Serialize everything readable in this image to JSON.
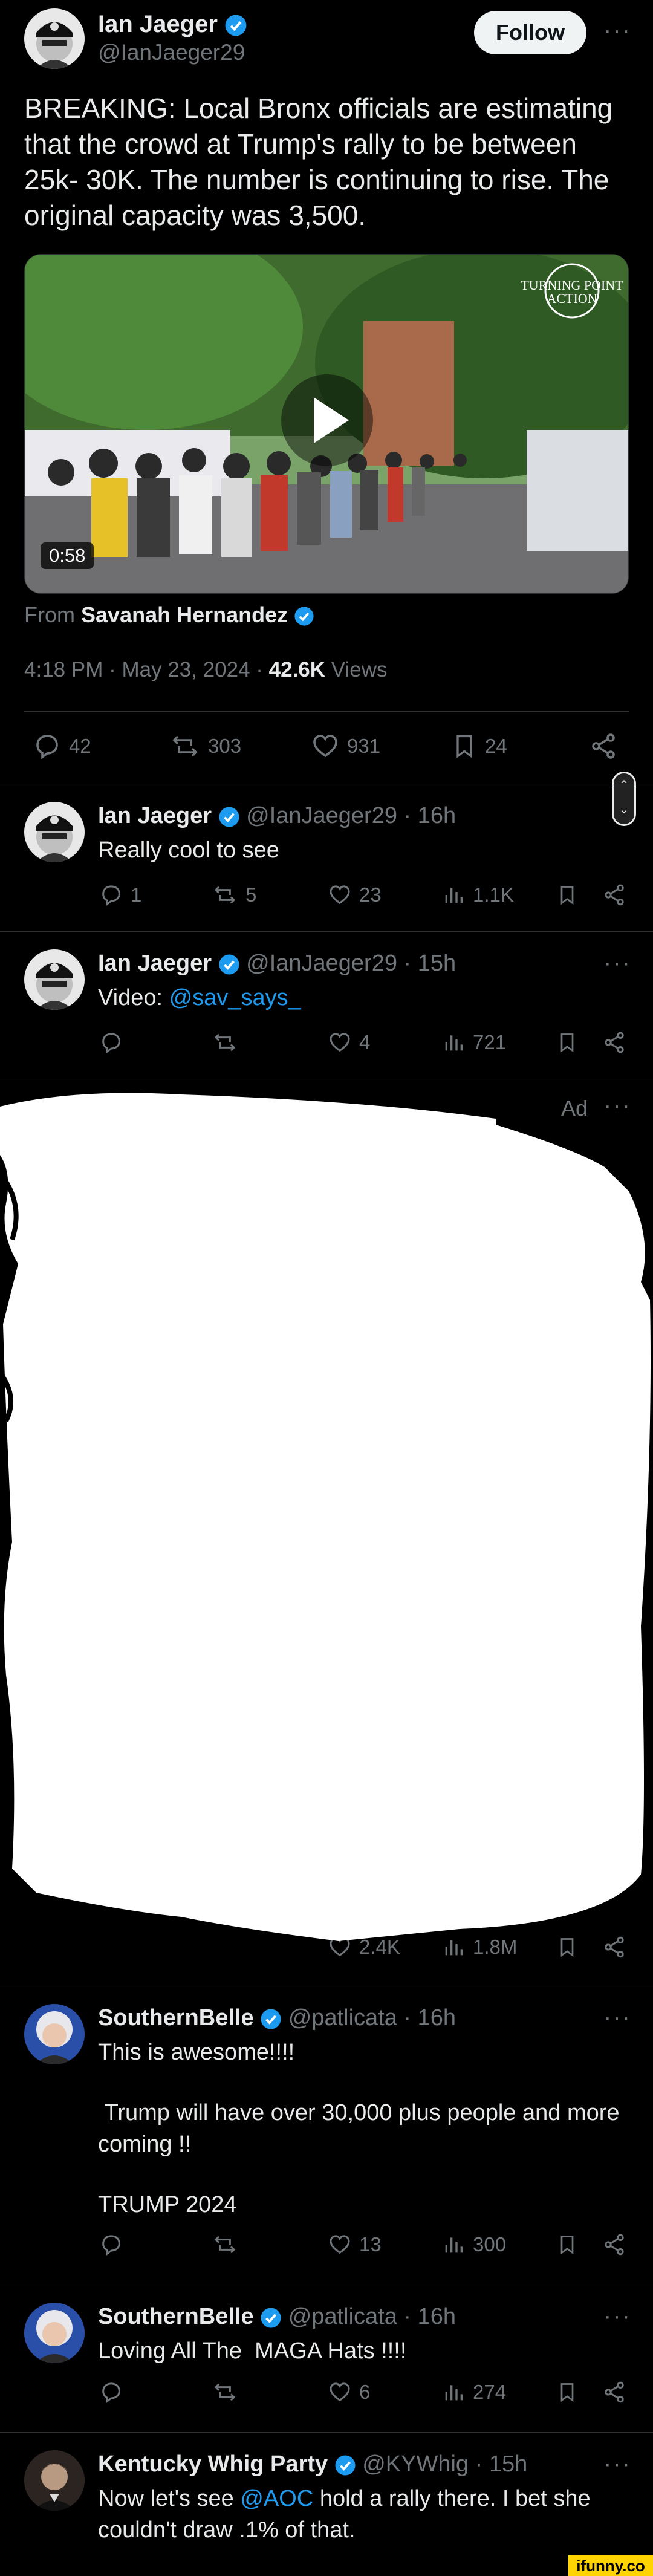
{
  "main_tweet": {
    "author_name": "Ian Jaeger",
    "handle": "@IanJaeger29",
    "follow_label": "Follow",
    "text": "BREAKING: Local Bronx officials are estimating that the crowd at Trump's rally to be between 25k- 30K. The number is continuing to rise. The original capacity was 3,500.",
    "video_duration": "0:58",
    "video_watermark": "TURNING POINT ACTION",
    "from_label": "From",
    "from_name": "Savanah Hernandez",
    "timestamp": "4:18 PM · May 23, 2024 · ",
    "views_count": "42.6K",
    "views_label": " Views",
    "stats": {
      "replies": "42",
      "reposts": "303",
      "likes": "931",
      "bookmarks": "24"
    }
  },
  "replies": [
    {
      "author_name": "Ian Jaeger",
      "handle_time": "@IanJaeger29 · 16h",
      "text": "Really cool to see",
      "stats": {
        "replies": "1",
        "reposts": "5",
        "likes": "23",
        "views": "1.1K"
      }
    },
    {
      "author_name": "Ian Jaeger",
      "handle_time": "@IanJaeger29 · 15h",
      "text_prefix": "Video: ",
      "mention": "@sav_says_",
      "stats": {
        "replies": "",
        "reposts": "",
        "likes": "4",
        "views": "721"
      }
    }
  ],
  "ad": {
    "label": "Ad",
    "stats": {
      "likes": "2.4K",
      "views": "1.8M"
    }
  },
  "replies_after_ad": [
    {
      "author_name": "SouthernBelle",
      "handle_time": "@patlicata · 16h",
      "line1": "This is awesome!!!!",
      "line2": " Trump will have over 30,000 plus people and more coming !!",
      "line3": "TRUMP 2024",
      "stats": {
        "replies": "",
        "reposts": "",
        "likes": "13",
        "views": "300"
      }
    },
    {
      "author_name": "SouthernBelle",
      "handle_time": "@patlicata · 16h",
      "text": "Loving All The  MAGA Hats !!!!",
      "stats": {
        "replies": "",
        "reposts": "",
        "likes": "6",
        "views": "274"
      }
    },
    {
      "author_name": "Kentucky Whig Party",
      "handle_time": "@KYWhig · 15h",
      "text_prefix": "Now let's see ",
      "mention": "@AOC",
      "text_suffix": " hold a rally there.  I bet she couldn't draw .1% of that."
    }
  ],
  "watermark": "ifunny.co",
  "colors": {
    "background": "#000000",
    "text": "#e7e9ea",
    "secondary": "#71767b",
    "accent": "#1d9bf0",
    "divider": "#2f3336"
  }
}
